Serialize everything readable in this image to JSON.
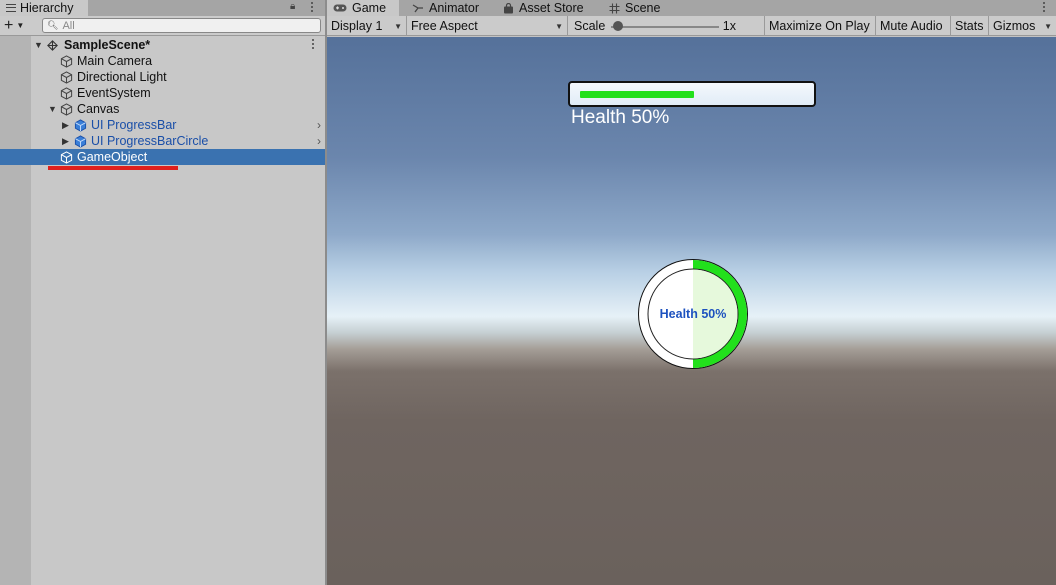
{
  "hierarchy": {
    "tab_label": "Hierarchy",
    "search_placeholder": "All",
    "items": [
      {
        "label": "SampleScene*",
        "kind": "scene",
        "expanded": true
      },
      {
        "label": "Main Camera",
        "kind": "object"
      },
      {
        "label": "Directional Light",
        "kind": "object"
      },
      {
        "label": "EventSystem",
        "kind": "object"
      },
      {
        "label": "Canvas",
        "kind": "object",
        "expanded": true
      },
      {
        "label": "UI ProgressBar",
        "kind": "prefab",
        "collapsed": true
      },
      {
        "label": "UI ProgressBarCircle",
        "kind": "prefab",
        "collapsed": true
      },
      {
        "label": "GameObject",
        "kind": "object",
        "selected": true
      }
    ]
  },
  "game_tabs": [
    {
      "label": "Game",
      "icon": "gamepad-icon",
      "active": true
    },
    {
      "label": "Animator",
      "icon": "animator-icon"
    },
    {
      "label": "Asset Store",
      "icon": "store-bag-icon"
    },
    {
      "label": "Scene",
      "icon": "grid-icon"
    }
  ],
  "game_toolbar": {
    "display": "Display 1",
    "aspect": "Free Aspect",
    "scale_label": "Scale",
    "scale_value": "1x",
    "maximize": "Maximize On Play",
    "mute": "Mute Audio",
    "stats": "Stats",
    "gizmos": "Gizmos"
  },
  "viewport": {
    "bar_label": "Health 50%",
    "bar_progress": 0.5,
    "circle_label": "Health 50%",
    "circle_progress": 0.5
  },
  "colors": {
    "accent_selection": "#3a72b0",
    "progress_green": "#22e01c",
    "prefab_blue": "#1a4fa8",
    "highlight_red": "#e0201c"
  }
}
